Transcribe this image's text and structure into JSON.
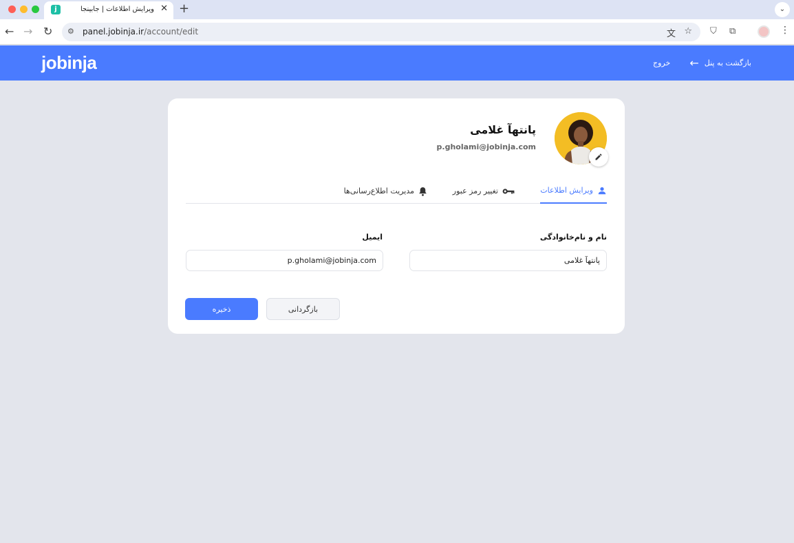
{
  "browser": {
    "tab_favicon_letter": "j",
    "tab_title": "ویرایش اطلاعات | جابینجا",
    "tab_close": "✕",
    "new_tab": "+",
    "url_host": "panel.jobinja.ir",
    "url_path": "/account/edit"
  },
  "header": {
    "logo": "jobinja",
    "back_to_panel": "بازگشت به پنل",
    "logout": "خروج",
    "accent_color": "#4a7bff"
  },
  "profile": {
    "name": "پانتهآ غلامی",
    "email": "p.gholami@jobinja.com"
  },
  "tabs": [
    {
      "label": "ویرایش اطلاعات",
      "icon": "user-icon",
      "active": true
    },
    {
      "label": "تغییر رمز عبور",
      "icon": "key-icon",
      "active": false
    },
    {
      "label": "مدیریت اطلاع‌رسانی‌ها",
      "icon": "bell-icon",
      "active": false
    }
  ],
  "form": {
    "name_label": "نام و نام‌خانوادگی",
    "name_value": "پانتهآ غلامی",
    "email_label": "ایمیل",
    "email_value": "p.gholami@jobinja.com",
    "save_label": "ذخیره",
    "cancel_label": "بازگردانی"
  }
}
